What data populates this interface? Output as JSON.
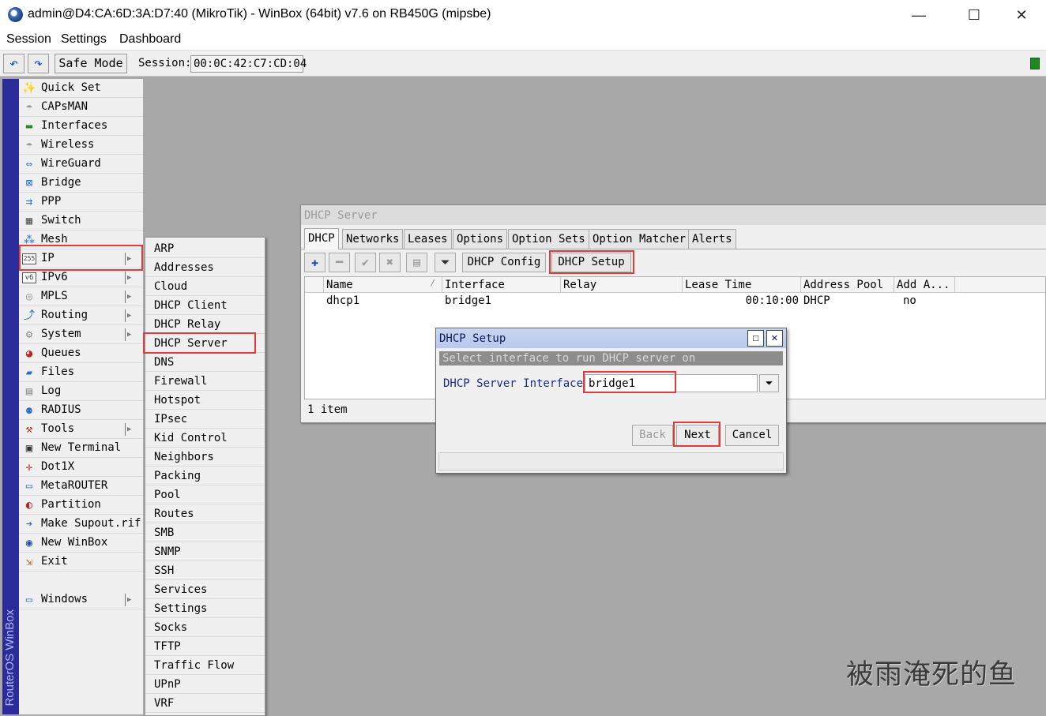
{
  "window": {
    "title": "admin@D4:CA:6D:3A:D7:40 (MikroTik) - WinBox (64bit) v7.6 on RB450G (mipsbe)",
    "minimize": "—",
    "maximize": "☐",
    "close": "✕"
  },
  "menubar": [
    "Session",
    "Settings",
    "Dashboard"
  ],
  "toolbar": {
    "undo": "↶",
    "redo": "↷",
    "safe_mode": "Safe Mode",
    "session_label": "Session:",
    "session_value": "00:0C:42:C7:CD:04"
  },
  "side_strip": "RouterOS WinBox",
  "sidebar": [
    {
      "label": "Quick Set",
      "icon": "✨",
      "color": "#888",
      "submenu": false
    },
    {
      "label": "CAPsMAN",
      "icon": "☂",
      "color": "#999",
      "submenu": false
    },
    {
      "label": "Interfaces",
      "icon": "▬",
      "color": "#2a8a2a",
      "submenu": false
    },
    {
      "label": "Wireless",
      "icon": "☂",
      "color": "#999",
      "submenu": false
    },
    {
      "label": "WireGuard",
      "icon": "⇔",
      "color": "#2a6fbf",
      "submenu": false
    },
    {
      "label": "Bridge",
      "icon": "⊠",
      "color": "#2a6fbf",
      "submenu": false
    },
    {
      "label": "PPP",
      "icon": "⇉",
      "color": "#2a6fbf",
      "submenu": false
    },
    {
      "label": "Switch",
      "icon": "▦",
      "color": "#555",
      "submenu": false
    },
    {
      "label": "Mesh",
      "icon": "⁂",
      "color": "#2a6fbf",
      "submenu": false
    },
    {
      "label": "IP",
      "icon": "255",
      "color": "#333",
      "submenu": true
    },
    {
      "label": "IPv6",
      "icon": "v6",
      "color": "#333",
      "submenu": true
    },
    {
      "label": "MPLS",
      "icon": "◎",
      "color": "#999",
      "submenu": true
    },
    {
      "label": "Routing",
      "icon": "⤴",
      "color": "#2a6fbf",
      "submenu": true
    },
    {
      "label": "System",
      "icon": "⚙",
      "color": "#888",
      "submenu": true
    },
    {
      "label": "Queues",
      "icon": "◕",
      "color": "#b22",
      "submenu": false
    },
    {
      "label": "Files",
      "icon": "▰",
      "color": "#2a6fbf",
      "submenu": false
    },
    {
      "label": "Log",
      "icon": "▤",
      "color": "#888",
      "submenu": false
    },
    {
      "label": "RADIUS",
      "icon": "⚉",
      "color": "#2a6fbf",
      "submenu": false
    },
    {
      "label": "Tools",
      "icon": "⚒",
      "color": "#b22",
      "submenu": true
    },
    {
      "label": "New Terminal",
      "icon": "▣",
      "color": "#333",
      "submenu": false
    },
    {
      "label": "Dot1X",
      "icon": "✛",
      "color": "#b22",
      "submenu": false
    },
    {
      "label": "MetaROUTER",
      "icon": "▭",
      "color": "#2a6fbf",
      "submenu": false
    },
    {
      "label": "Partition",
      "icon": "◐",
      "color": "#b22",
      "submenu": false
    },
    {
      "label": "Make Supout.rif",
      "icon": "➔",
      "color": "#2a6fbf",
      "submenu": false
    },
    {
      "label": "New WinBox",
      "icon": "◉",
      "color": "#2a4f9f",
      "submenu": false
    },
    {
      "label": "Exit",
      "icon": "⇲",
      "color": "#b5651d",
      "submenu": false
    }
  ],
  "sidebar_windows": {
    "label": "Windows",
    "icon": "▭",
    "color": "#2a6fbf",
    "submenu": true
  },
  "ip_submenu": [
    "ARP",
    "Addresses",
    "Cloud",
    "DHCP Client",
    "DHCP Relay",
    "DHCP Server",
    "DNS",
    "Firewall",
    "Hotspot",
    "IPsec",
    "Kid Control",
    "Neighbors",
    "Packing",
    "Pool",
    "Routes",
    "SMB",
    "SNMP",
    "SSH",
    "Services",
    "Settings",
    "Socks",
    "TFTP",
    "Traffic Flow",
    "UPnP",
    "VRF"
  ],
  "dhcp_window": {
    "title": "DHCP Server",
    "tabs": [
      "DHCP",
      "Networks",
      "Leases",
      "Options",
      "Option Sets",
      "Option Matcher",
      "Alerts"
    ],
    "buttons": {
      "add": "✚",
      "remove": "━",
      "enable": "✔",
      "disable": "✖",
      "comment": "▤",
      "filter": "⏷",
      "config": "DHCP Config",
      "setup": "DHCP Setup"
    },
    "columns": [
      "Name",
      "Interface",
      "Relay",
      "Lease Time",
      "Address Pool",
      "Add A..."
    ],
    "rows": [
      {
        "name": "dhcp1",
        "interface": "bridge1",
        "relay": "",
        "lease_time": "00:10:00",
        "address_pool": "DHCP",
        "add_arp": "no"
      }
    ],
    "item_count": "1 item"
  },
  "setup_dialog": {
    "title": "DHCP Setup",
    "maximize": "☐",
    "close": "✕",
    "banner": "Select interface to run DHCP server on",
    "field_label": "DHCP Server Interface:",
    "field_value": "bridge1",
    "dropdown": "⏷",
    "back": "Back",
    "next": "Next",
    "cancel": "Cancel"
  },
  "watermark": "被雨淹死的鱼"
}
